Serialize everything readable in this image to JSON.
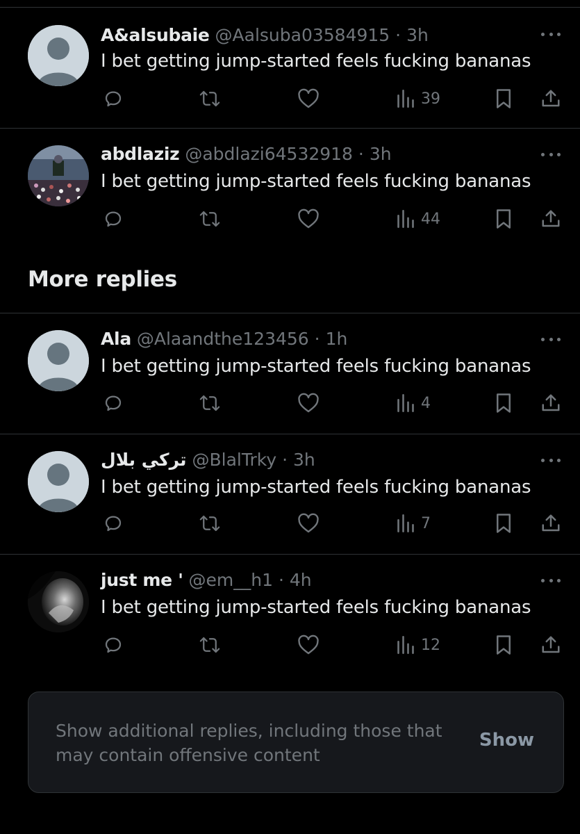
{
  "replies_top": [
    {
      "name": "A&alsubaie",
      "handle": "@Aalsuba03584915",
      "dot": "·",
      "time": "3h",
      "text": "I bet getting jump-started feels fucking bananas",
      "views": "39",
      "avatar": "default-avatar"
    },
    {
      "name": "abdlaziz",
      "handle": "@abdlazi64532918",
      "dot": "·",
      "time": "3h",
      "text": "I bet getting jump-started feels fucking bananas",
      "views": "44",
      "avatar": "crowd-photo-avatar"
    }
  ],
  "section": {
    "title": "More replies"
  },
  "replies_more": [
    {
      "name": "Ala",
      "handle": "@Alaandthe123456",
      "dot": "·",
      "time": "1h",
      "text": "I bet getting jump-started feels fucking bananas",
      "views": "4",
      "avatar": "default-avatar"
    },
    {
      "name": "تركي بلال",
      "handle": "@BlalTrky",
      "dot": "·",
      "time": "3h",
      "text": "I bet getting jump-started feels fucking bananas",
      "views": "7",
      "avatar": "default-avatar"
    },
    {
      "name": "just me '",
      "handle": "@em__h1",
      "dot": "·",
      "time": "4h",
      "text": "I bet getting jump-started feels fucking bananas",
      "views": "12",
      "avatar": "dark-portrait-avatar"
    }
  ],
  "notice": {
    "text": "Show additional replies, including those that may contain offensive content",
    "button_label": "Show"
  },
  "colors": {
    "background": "#000000",
    "text_primary": "#e7e9ea",
    "text_secondary": "#71767b",
    "divider": "#2f3336",
    "notice_bg": "#16181c"
  },
  "icons": [
    "reply-icon",
    "retweet-icon",
    "like-icon",
    "views-icon",
    "bookmark-icon",
    "share-icon",
    "more-icon"
  ]
}
